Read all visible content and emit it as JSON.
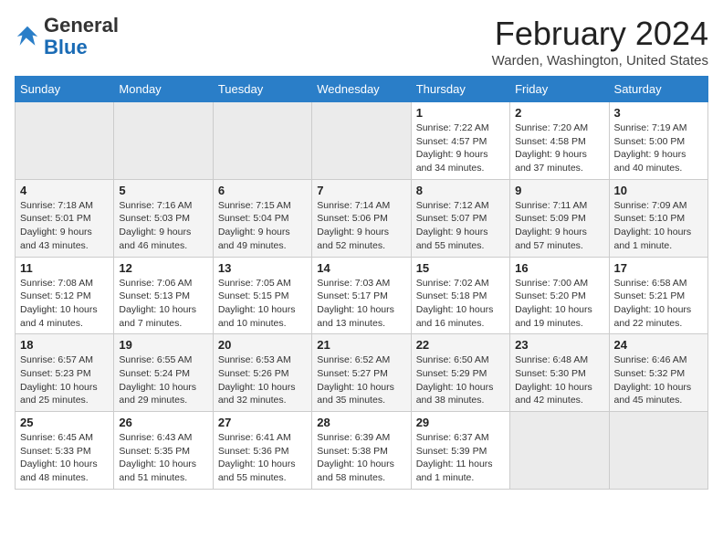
{
  "header": {
    "logo_general": "General",
    "logo_blue": "Blue",
    "month_title": "February 2024",
    "location": "Warden, Washington, United States"
  },
  "days_of_week": [
    "Sunday",
    "Monday",
    "Tuesday",
    "Wednesday",
    "Thursday",
    "Friday",
    "Saturday"
  ],
  "weeks": [
    [
      {
        "day": "",
        "info": ""
      },
      {
        "day": "",
        "info": ""
      },
      {
        "day": "",
        "info": ""
      },
      {
        "day": "",
        "info": ""
      },
      {
        "day": "1",
        "info": "Sunrise: 7:22 AM\nSunset: 4:57 PM\nDaylight: 9 hours\nand 34 minutes."
      },
      {
        "day": "2",
        "info": "Sunrise: 7:20 AM\nSunset: 4:58 PM\nDaylight: 9 hours\nand 37 minutes."
      },
      {
        "day": "3",
        "info": "Sunrise: 7:19 AM\nSunset: 5:00 PM\nDaylight: 9 hours\nand 40 minutes."
      }
    ],
    [
      {
        "day": "4",
        "info": "Sunrise: 7:18 AM\nSunset: 5:01 PM\nDaylight: 9 hours\nand 43 minutes."
      },
      {
        "day": "5",
        "info": "Sunrise: 7:16 AM\nSunset: 5:03 PM\nDaylight: 9 hours\nand 46 minutes."
      },
      {
        "day": "6",
        "info": "Sunrise: 7:15 AM\nSunset: 5:04 PM\nDaylight: 9 hours\nand 49 minutes."
      },
      {
        "day": "7",
        "info": "Sunrise: 7:14 AM\nSunset: 5:06 PM\nDaylight: 9 hours\nand 52 minutes."
      },
      {
        "day": "8",
        "info": "Sunrise: 7:12 AM\nSunset: 5:07 PM\nDaylight: 9 hours\nand 55 minutes."
      },
      {
        "day": "9",
        "info": "Sunrise: 7:11 AM\nSunset: 5:09 PM\nDaylight: 9 hours\nand 57 minutes."
      },
      {
        "day": "10",
        "info": "Sunrise: 7:09 AM\nSunset: 5:10 PM\nDaylight: 10 hours\nand 1 minute."
      }
    ],
    [
      {
        "day": "11",
        "info": "Sunrise: 7:08 AM\nSunset: 5:12 PM\nDaylight: 10 hours\nand 4 minutes."
      },
      {
        "day": "12",
        "info": "Sunrise: 7:06 AM\nSunset: 5:13 PM\nDaylight: 10 hours\nand 7 minutes."
      },
      {
        "day": "13",
        "info": "Sunrise: 7:05 AM\nSunset: 5:15 PM\nDaylight: 10 hours\nand 10 minutes."
      },
      {
        "day": "14",
        "info": "Sunrise: 7:03 AM\nSunset: 5:17 PM\nDaylight: 10 hours\nand 13 minutes."
      },
      {
        "day": "15",
        "info": "Sunrise: 7:02 AM\nSunset: 5:18 PM\nDaylight: 10 hours\nand 16 minutes."
      },
      {
        "day": "16",
        "info": "Sunrise: 7:00 AM\nSunset: 5:20 PM\nDaylight: 10 hours\nand 19 minutes."
      },
      {
        "day": "17",
        "info": "Sunrise: 6:58 AM\nSunset: 5:21 PM\nDaylight: 10 hours\nand 22 minutes."
      }
    ],
    [
      {
        "day": "18",
        "info": "Sunrise: 6:57 AM\nSunset: 5:23 PM\nDaylight: 10 hours\nand 25 minutes."
      },
      {
        "day": "19",
        "info": "Sunrise: 6:55 AM\nSunset: 5:24 PM\nDaylight: 10 hours\nand 29 minutes."
      },
      {
        "day": "20",
        "info": "Sunrise: 6:53 AM\nSunset: 5:26 PM\nDaylight: 10 hours\nand 32 minutes."
      },
      {
        "day": "21",
        "info": "Sunrise: 6:52 AM\nSunset: 5:27 PM\nDaylight: 10 hours\nand 35 minutes."
      },
      {
        "day": "22",
        "info": "Sunrise: 6:50 AM\nSunset: 5:29 PM\nDaylight: 10 hours\nand 38 minutes."
      },
      {
        "day": "23",
        "info": "Sunrise: 6:48 AM\nSunset: 5:30 PM\nDaylight: 10 hours\nand 42 minutes."
      },
      {
        "day": "24",
        "info": "Sunrise: 6:46 AM\nSunset: 5:32 PM\nDaylight: 10 hours\nand 45 minutes."
      }
    ],
    [
      {
        "day": "25",
        "info": "Sunrise: 6:45 AM\nSunset: 5:33 PM\nDaylight: 10 hours\nand 48 minutes."
      },
      {
        "day": "26",
        "info": "Sunrise: 6:43 AM\nSunset: 5:35 PM\nDaylight: 10 hours\nand 51 minutes."
      },
      {
        "day": "27",
        "info": "Sunrise: 6:41 AM\nSunset: 5:36 PM\nDaylight: 10 hours\nand 55 minutes."
      },
      {
        "day": "28",
        "info": "Sunrise: 6:39 AM\nSunset: 5:38 PM\nDaylight: 10 hours\nand 58 minutes."
      },
      {
        "day": "29",
        "info": "Sunrise: 6:37 AM\nSunset: 5:39 PM\nDaylight: 11 hours\nand 1 minute."
      },
      {
        "day": "",
        "info": ""
      },
      {
        "day": "",
        "info": ""
      }
    ]
  ]
}
